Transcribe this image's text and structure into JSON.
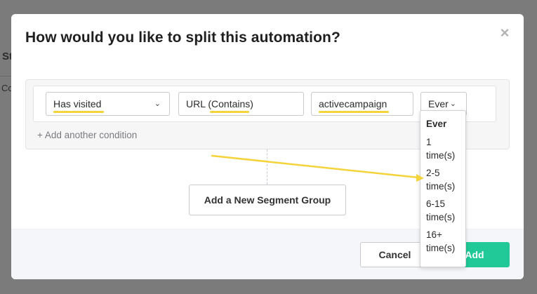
{
  "background": {
    "fragment_1": "St",
    "fragment_2": "Co"
  },
  "modal": {
    "title": "How would you like to split this automation?",
    "close_icon": "×"
  },
  "condition": {
    "field_1": "Has visited",
    "field_2": "URL (Contains)",
    "field_3": "activecampaign",
    "field_4": "Ever",
    "chevron": "⌄"
  },
  "add_condition_label": "+ Add another condition",
  "segment_group_label": "Add a New Segment Group",
  "dropdown": {
    "options": [
      "Ever",
      "1 time(s)",
      "2-5 time(s)",
      "6-15 time(s)",
      "16+ time(s)"
    ]
  },
  "footer": {
    "cancel_label": "Cancel",
    "add_label": "Add"
  },
  "colors": {
    "accent_green": "#20c997",
    "highlight_yellow": "#f5d33b"
  }
}
